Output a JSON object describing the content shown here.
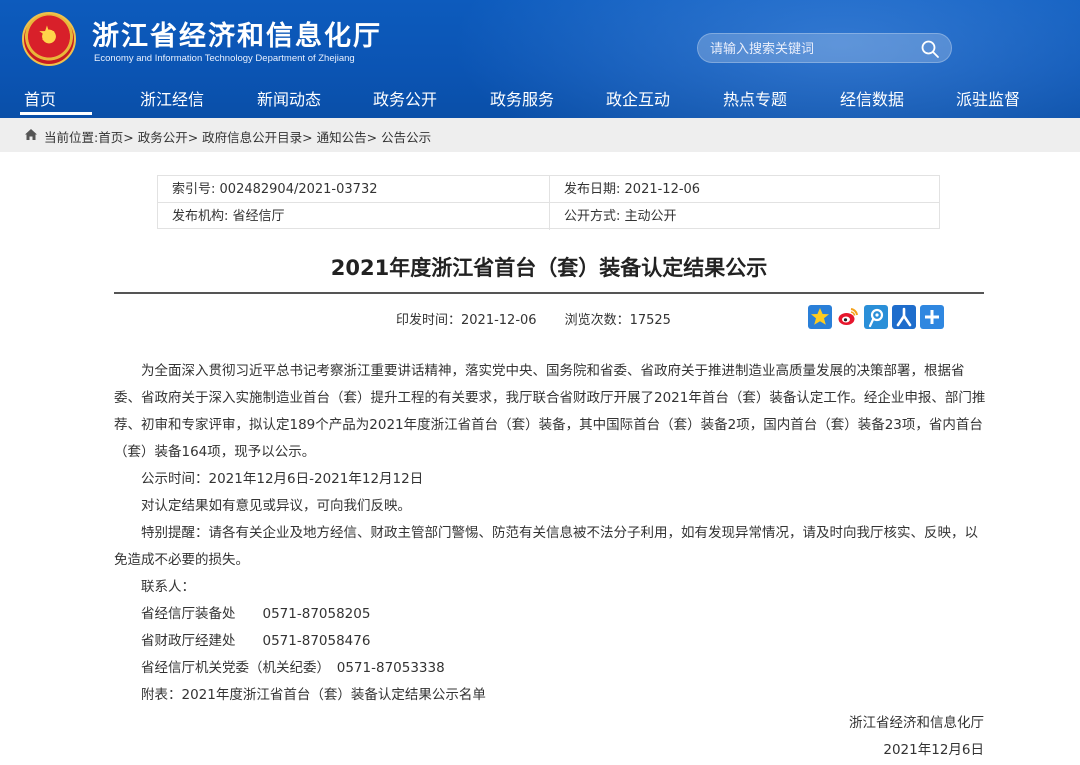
{
  "header": {
    "title": "浙江省经济和信息化厅",
    "subtitle": "Economy and Information Technology Department of Zhejiang",
    "search_placeholder": "请输入搜索关键词"
  },
  "nav": {
    "items": [
      "首页",
      "浙江经信",
      "新闻动态",
      "政务公开",
      "政务服务",
      "政企互动",
      "热点专题",
      "经信数据",
      "派驻监督"
    ],
    "active": "首页"
  },
  "breadcrumb": {
    "label": "当前位置:",
    "path": [
      "首页",
      "政务公开",
      "政府信息公开目录",
      "通知公告",
      "公告公示"
    ]
  },
  "meta": {
    "index_label": "索引号:",
    "index_value": "002482904/2021-03732",
    "date_label": "发布日期:",
    "date_value": "2021-12-06",
    "org_label": "发布机构:",
    "org_value": "省经信厅",
    "mode_label": "公开方式:",
    "mode_value": "主动公开"
  },
  "article": {
    "title": "2021年度浙江省首台（套）装备认定结果公示",
    "print_label": "印发时间：",
    "print_date": "2021-12-06",
    "views_label": "浏览次数：",
    "views": "17525",
    "p1_l1": "为全面深入贯彻习近平总书记考察浙江重要讲话精神，落实党中央、国务院和省委、省政府关于推进制造业高质量发展的决策部署，根据省",
    "p1_l2": "委、省政府关于深入实施制造业首台（套）提升工程的有关要求，我厅联合省财政厅开展了2021年首台（套）装备认定工作。经企业申报、部门推",
    "p1_l3": "荐、初审和专家评审，拟认定189个产品为2021年度浙江省首台（套）装备，其中国际首台（套）装备2项，国内首台（套）装备23项，省内首台",
    "p1_l4": "（套）装备164项，现予以公示。",
    "p2": "公示时间：2021年12月6日-2021年12月12日",
    "p3": "对认定结果如有意见或异议，可向我们反映。",
    "p4_l1": "特别提醒：请各有关企业及地方经信、财政主管部门警惕、防范有关信息被不法分子利用，如有发现异常情况，请及时向我厅核实、反映，以",
    "p4_l2": "免造成不必要的损失。",
    "contact_label": "联系人：",
    "contact1": "省经信厅装备处　　0571-87058205",
    "contact2": "省财政厅经建处　　0571-87058476",
    "contact3": "省经信厅机关党委（机关纪委）　0571-87053338",
    "attachment": "附表：2021年度浙江省首台（套）装备认定结果公示名单",
    "sign_org": "浙江省经济和信息化厅",
    "sign_date": "2021年12月6日"
  },
  "colors": {
    "header_blue": "#0b54b3",
    "breadcrumb_bg": "#eeeeee"
  },
  "icons": [
    "emblem-icon",
    "search-icon",
    "home-icon",
    "qzone-share-icon",
    "weibo-share-icon",
    "tencent-weibo-share-icon",
    "renren-share-icon",
    "more-share-icon"
  ]
}
